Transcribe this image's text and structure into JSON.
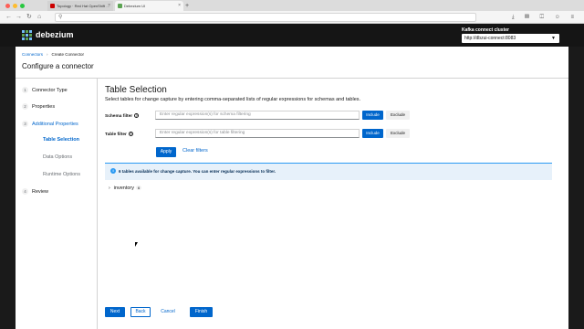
{
  "browser": {
    "tabs": [
      {
        "label": "Topology · Red Hat OpenShift …",
        "active": false
      },
      {
        "label": "Debezium UI",
        "active": true
      }
    ],
    "nav_icons": [
      "back-icon",
      "forward-icon",
      "reload-icon",
      "home-icon"
    ]
  },
  "header": {
    "brand": "debezium",
    "cluster_label": "Kafka connect cluster",
    "cluster_value": "http://dbzui-connect:8083"
  },
  "breadcrumb": {
    "root": "Connectors",
    "current": "Create Connector"
  },
  "page_title": "Configure a connector",
  "wizard": {
    "steps": [
      {
        "num": "1",
        "label": "Connector Type"
      },
      {
        "num": "2",
        "label": "Properties"
      },
      {
        "num": "3",
        "label": "Additional Properties"
      },
      {
        "num": "4",
        "label": "Review"
      }
    ],
    "substeps": [
      {
        "label": "Table Selection"
      },
      {
        "label": "Data Options"
      },
      {
        "label": "Runtime Options"
      }
    ]
  },
  "main": {
    "heading": "Table Selection",
    "description": "Select tables for change capture by entering comma-separated lists of regular expressions for schemas and tables.",
    "schema_filter": {
      "label": "Schema filter",
      "placeholder": "Enter regular expression(s) for schema filtering",
      "include": "Include",
      "exclude": "Exclude"
    },
    "table_filter": {
      "label": "Table filter",
      "placeholder": "Enter regular expression(s) for table filtering",
      "include": "Include",
      "exclude": "Exclude"
    },
    "apply": "Apply",
    "clear": "Clear filters",
    "alert": "6 tables available for change capture. You can enter regular expressions to filter.",
    "tree": {
      "name": "inventory",
      "count": "6"
    }
  },
  "footer": {
    "next": "Next",
    "back": "Back",
    "cancel": "Cancel",
    "finish": "Finish"
  }
}
